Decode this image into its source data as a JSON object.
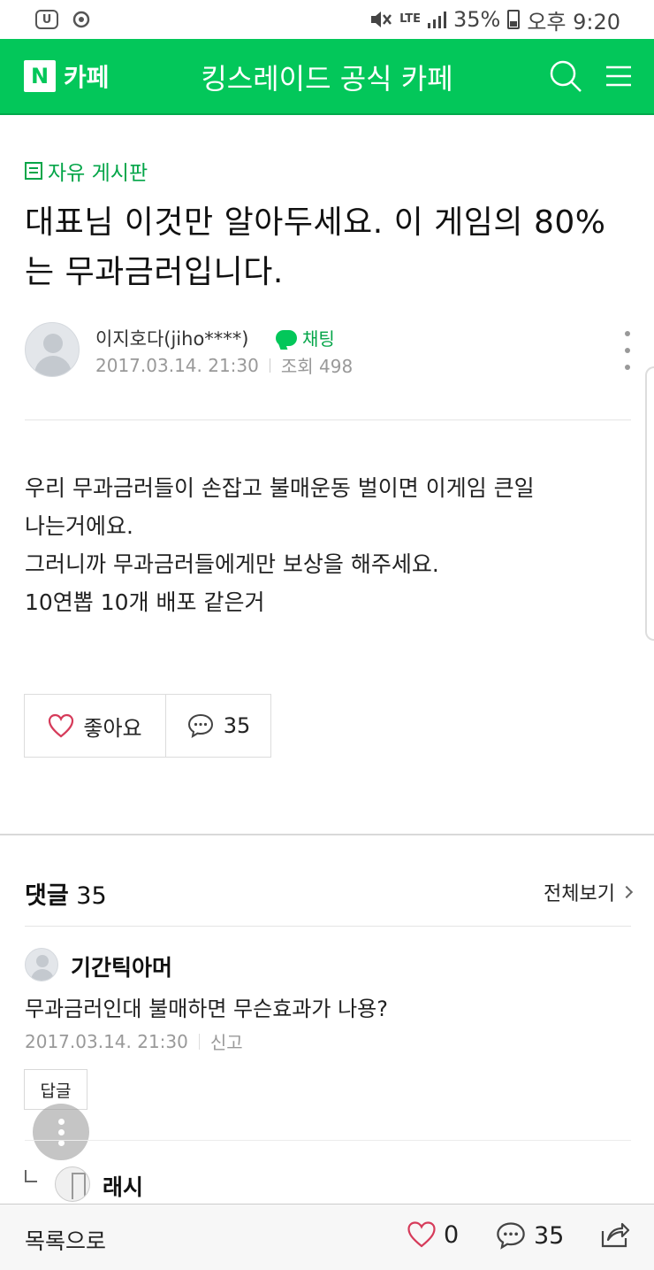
{
  "status_bar": {
    "lte": "LTE",
    "battery": "35%",
    "time": "오후 9:20"
  },
  "header": {
    "service_logo": "N",
    "service": "카페",
    "title": "킹스레이드 공식 카페"
  },
  "article": {
    "board": "자유 게시판",
    "title": "대표님 이것만 알아두세요. 이 게임의 80%는 무과금러입니다.",
    "author": "이지호다(jiho****)",
    "chat_label": "채팅",
    "date": "2017.03.14. 21:30",
    "views": "조회 498",
    "body": [
      "우리 무과금러들이 손잡고 불매운동 벌이면 이게임 큰일",
      "나는거에요.",
      "그러니까 무과금러들에게만 보상을 해주세요.",
      "10연뽑 10개 배포 같은거"
    ],
    "like_label": "좋아요",
    "comment_count": "35"
  },
  "comments": {
    "heading": "댓글",
    "count": "35",
    "view_all": "전체보기",
    "items": [
      {
        "nickname": "기간틱아머",
        "text": "무과금러인대 불매하면 무슨효과가 나용?",
        "date": "2017.03.14. 21:30",
        "report": "신고",
        "reply_label": "답글"
      }
    ],
    "replies": [
      {
        "nickname": "래시"
      }
    ]
  },
  "bottom_bar": {
    "list_label": "목록으로",
    "likes": "0",
    "comments": "35"
  },
  "colors": {
    "brand": "#03c75a",
    "heart": "#d63b5a"
  }
}
